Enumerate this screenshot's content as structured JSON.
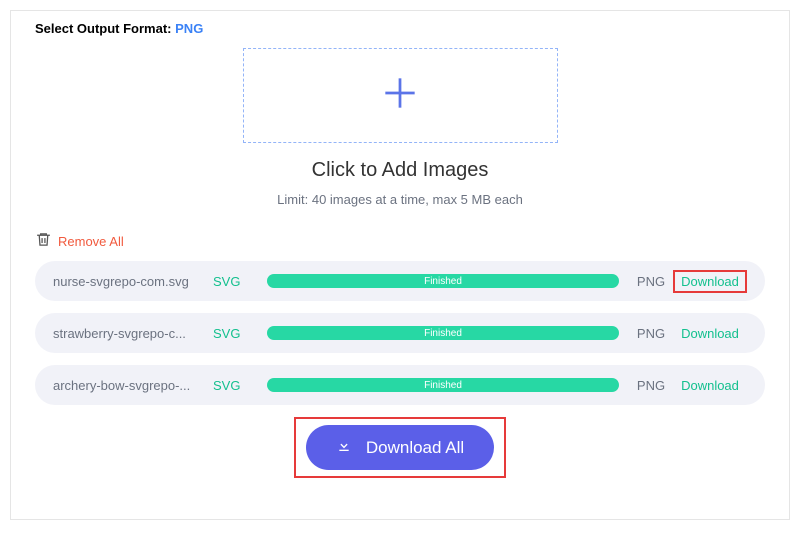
{
  "header": {
    "label": "Select Output Format:",
    "value": "PNG"
  },
  "dropzone": {
    "title": "Click to Add Images",
    "limit": "Limit: 40 images at a time, max 5 MB each"
  },
  "remove_all": "Remove All",
  "files": [
    {
      "name": "nurse-svgrepo-com.svg",
      "in": "SVG",
      "status": "Finished",
      "out": "PNG",
      "download": "Download",
      "highlight": true
    },
    {
      "name": "strawberry-svgrepo-c...",
      "in": "SVG",
      "status": "Finished",
      "out": "PNG",
      "download": "Download",
      "highlight": false
    },
    {
      "name": "archery-bow-svgrepo-...",
      "in": "SVG",
      "status": "Finished",
      "out": "PNG",
      "download": "Download",
      "highlight": false
    }
  ],
  "download_all": "Download All",
  "colors": {
    "accent": "#5b5fe8",
    "success": "#27d8a4",
    "success_text": "#13c08e",
    "danger": "#e63a3a",
    "remove": "#f15a3e",
    "link": "#3b82f6"
  }
}
